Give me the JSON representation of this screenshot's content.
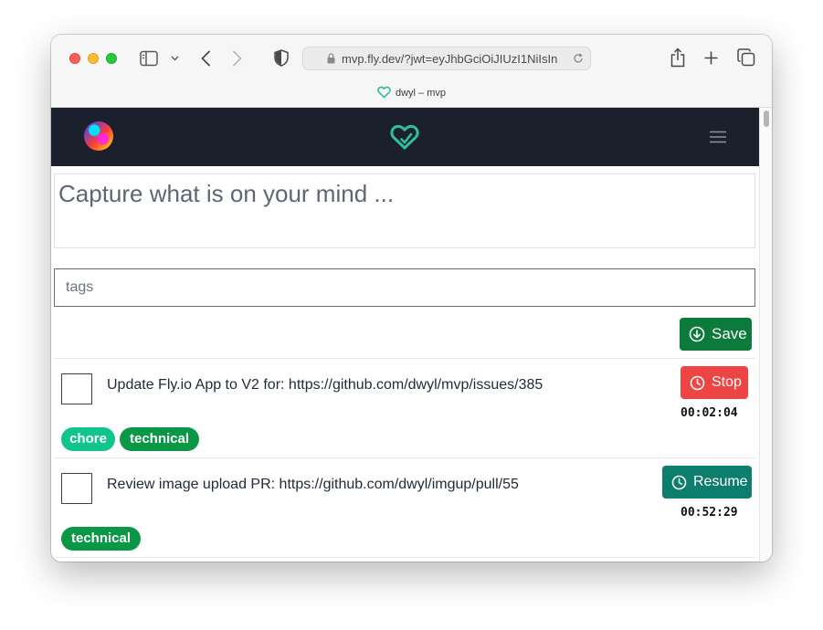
{
  "browser": {
    "url": "mvp.fly.dev/?jwt=eyJhbGciOiJIUzI1NiIsIn",
    "tab_title": "dwyl – mvp"
  },
  "app": {
    "capture_placeholder": "Capture what is on your mind ...",
    "tags_placeholder": "tags",
    "save_label": "Save"
  },
  "items": [
    {
      "text": "Update Fly.io App to V2 for: https://github.com/dwyl/mvp/issues/385",
      "action_label": "Stop",
      "timer": "00:02:04",
      "tags": [
        "chore",
        "technical"
      ]
    },
    {
      "text": "Review image upload PR: https://github.com/dwyl/imgup/pull/55",
      "action_label": "Resume",
      "timer": "00:52:29",
      "tags": [
        "technical"
      ]
    }
  ],
  "colors": {
    "nav_bg": "#1a202c",
    "brand_teal": "#2fbf9f",
    "save_green": "#0b7a3b",
    "stop_red": "#ef4444",
    "resume_teal": "#0d7d6e",
    "tag_chore": "#10c48c",
    "tag_technical": "#0a9846"
  },
  "icons": {
    "sidebar": "sidebar-icon",
    "back": "chevron-left-icon",
    "forward": "chevron-right-icon",
    "shield": "shield-icon",
    "share": "share-icon",
    "new_tab": "plus-icon",
    "tabs": "tabs-overview-icon",
    "logo": "heart-logo-icon",
    "menu": "hamburger-menu-icon",
    "save": "arrow-down-circle-icon",
    "clock": "clock-icon"
  }
}
